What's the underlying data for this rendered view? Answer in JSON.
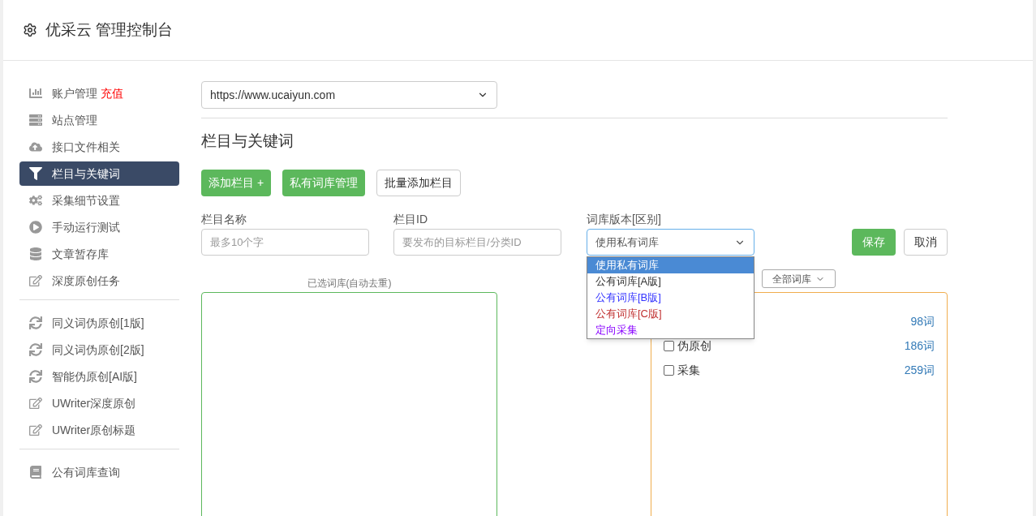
{
  "header": {
    "title": "优采云 管理控制台"
  },
  "sidebar": {
    "groups": [
      {
        "items": [
          {
            "label": "账户管理",
            "badge": "充值",
            "selected": false
          },
          {
            "label": "站点管理",
            "selected": false
          },
          {
            "label": "接口文件相关",
            "selected": false
          },
          {
            "label": "栏目与关键词",
            "selected": true
          },
          {
            "label": "采集细节设置",
            "selected": false
          },
          {
            "label": "手动运行测试",
            "selected": false
          },
          {
            "label": "文章暂存库",
            "selected": false
          },
          {
            "label": "深度原创任务",
            "selected": false
          }
        ]
      },
      {
        "items": [
          {
            "label": "同义词伪原创[1版]",
            "selected": false
          },
          {
            "label": "同义词伪原创[2版]",
            "selected": false
          },
          {
            "label": "智能伪原创[AI版]",
            "selected": false
          },
          {
            "label": "UWriter深度原创",
            "selected": false
          },
          {
            "label": "UWriter原创标题",
            "selected": false
          }
        ]
      },
      {
        "items": [
          {
            "label": "公有词库查询",
            "selected": false
          }
        ]
      }
    ]
  },
  "site_select": {
    "value": "https://www.ucaiyun.com"
  },
  "section_title": "栏目与关键词",
  "toolbar": [
    {
      "label": "添加栏目 +",
      "kind": "primary"
    },
    {
      "label": "私有词库管理",
      "kind": "primary"
    },
    {
      "label": "批量添加栏目",
      "kind": "default"
    }
  ],
  "form": {
    "name_label": "栏目名称",
    "name_placeholder": "最多10个字",
    "id_label": "栏目ID",
    "id_placeholder": "要发布的目标栏目/分类ID",
    "lib_label": "词库版本[区别]",
    "lib_value": "使用私有词库",
    "save": "保存",
    "cancel": "取消",
    "lib_options": [
      {
        "label": "使用私有词库",
        "selected": true,
        "color": "#ffffff"
      },
      {
        "label": "公有词库[A版]",
        "selected": false,
        "color": "#333333"
      },
      {
        "label": "公有词库[B版]",
        "selected": false,
        "color": "#3333ff"
      },
      {
        "label": "公有词库[C版]",
        "selected": false,
        "color": "#c03030"
      },
      {
        "label": "定向采集",
        "selected": false,
        "color": "#8800ff"
      }
    ]
  },
  "selected_libs": {
    "label": "已选词库(自动去重)"
  },
  "library_filter": {
    "value": "全部词库"
  },
  "libraries": [
    {
      "count": "98词"
    },
    {
      "label": "伪原创",
      "count": "186词",
      "checked": false
    },
    {
      "label": "采集",
      "count": "259词",
      "checked": false
    }
  ]
}
